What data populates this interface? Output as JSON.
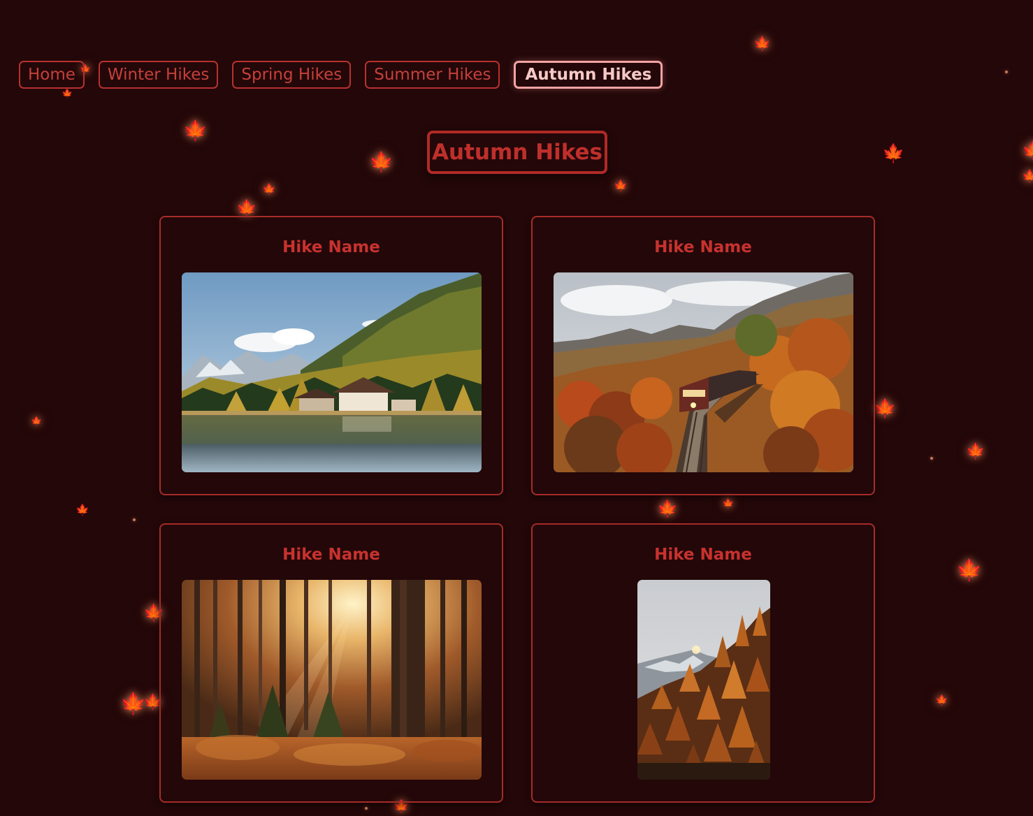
{
  "nav": {
    "items": [
      {
        "label": "Home",
        "active": false
      },
      {
        "label": "Winter Hikes",
        "active": false
      },
      {
        "label": "Spring Hikes",
        "active": false
      },
      {
        "label": "Summer Hikes",
        "active": false
      },
      {
        "label": "Autumn Hikes",
        "active": true
      }
    ]
  },
  "page": {
    "title": "Autumn Hikes"
  },
  "cards": [
    {
      "title": "Hike Name",
      "image": "lake-chalet-autumn-forest"
    },
    {
      "title": "Hike Name",
      "image": "train-autumn-mountain-bridge"
    },
    {
      "title": "Hike Name",
      "image": "sunlit-autumn-forest"
    },
    {
      "title": "Hike Name",
      "image": "autumn-larch-mountain"
    }
  ],
  "decoration": {
    "icon": "maple-leaf-icon",
    "accent": "#c8322e",
    "background": "#230709"
  }
}
